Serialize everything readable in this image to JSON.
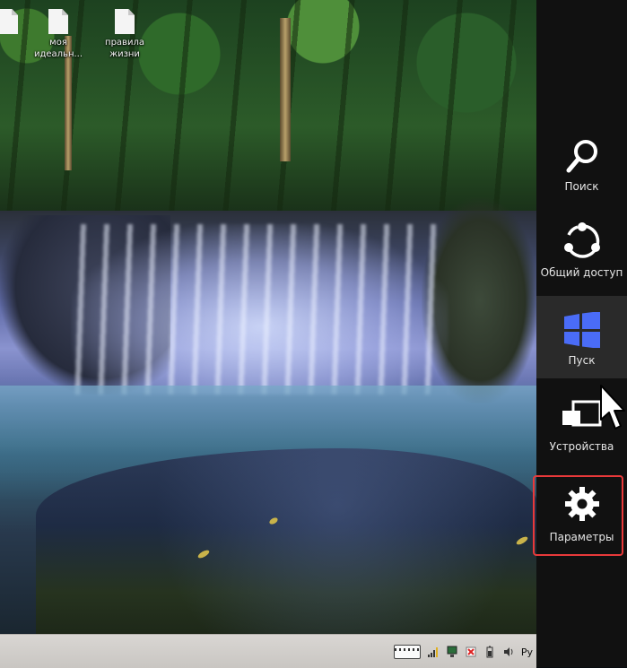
{
  "desktop": {
    "icons": [
      {
        "label_line1": "моя",
        "label_line2": "идеальн...",
        "icon": "text-file-icon"
      },
      {
        "label_line1": "правила",
        "label_line2": "жизни",
        "icon": "text-file-icon"
      }
    ]
  },
  "charms": {
    "items": [
      {
        "label": "Поиск",
        "icon": "search-icon"
      },
      {
        "label": "Общий доступ",
        "icon": "share-icon"
      },
      {
        "label": "Пуск",
        "icon": "windows-start-icon"
      },
      {
        "label": "Устройства",
        "icon": "devices-icon"
      },
      {
        "label": "Параметры",
        "icon": "settings-gear-icon"
      }
    ],
    "highlighted": "Параметры",
    "highlight_color": "#e8393a",
    "start_icon_color": "#4a6cf7"
  },
  "taskbar": {
    "language": "Ру",
    "tray_icons": [
      "keyboard-icon",
      "signal-icon",
      "network-icon",
      "flag-alert-icon",
      "battery-icon",
      "volume-icon"
    ]
  }
}
